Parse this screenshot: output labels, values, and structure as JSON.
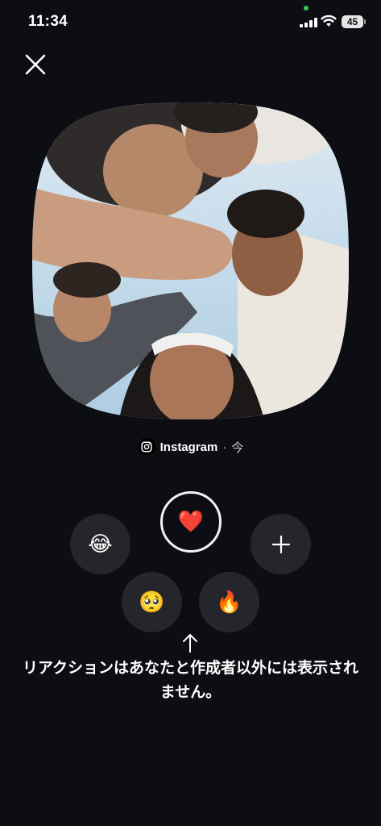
{
  "status_bar": {
    "time": "11:34",
    "battery": "45"
  },
  "story": {
    "account": "Instagram",
    "separator": "·",
    "posted": "今"
  },
  "reactions": {
    "selected": "❤️",
    "items": [
      {
        "name": "heart",
        "emoji": "❤️",
        "selected": true
      },
      {
        "name": "laugh",
        "emoji": "😂",
        "selected": false
      },
      {
        "name": "add",
        "emoji": "+",
        "selected": false
      },
      {
        "name": "pleading",
        "emoji": "🥺",
        "selected": false
      },
      {
        "name": "fire",
        "emoji": "🔥",
        "selected": false
      }
    ]
  },
  "notice": {
    "line1": "リアクションはあなたと作成者以外には表示され",
    "line2": "ません。"
  },
  "colors": {
    "background": "#0c0e13",
    "reaction_bg": "#24262b",
    "status_dot": "#34c759"
  },
  "icons": {
    "close": "close-icon",
    "add": "plus-icon",
    "hint": "arrow-up-icon",
    "brand": "instagram-icon"
  }
}
